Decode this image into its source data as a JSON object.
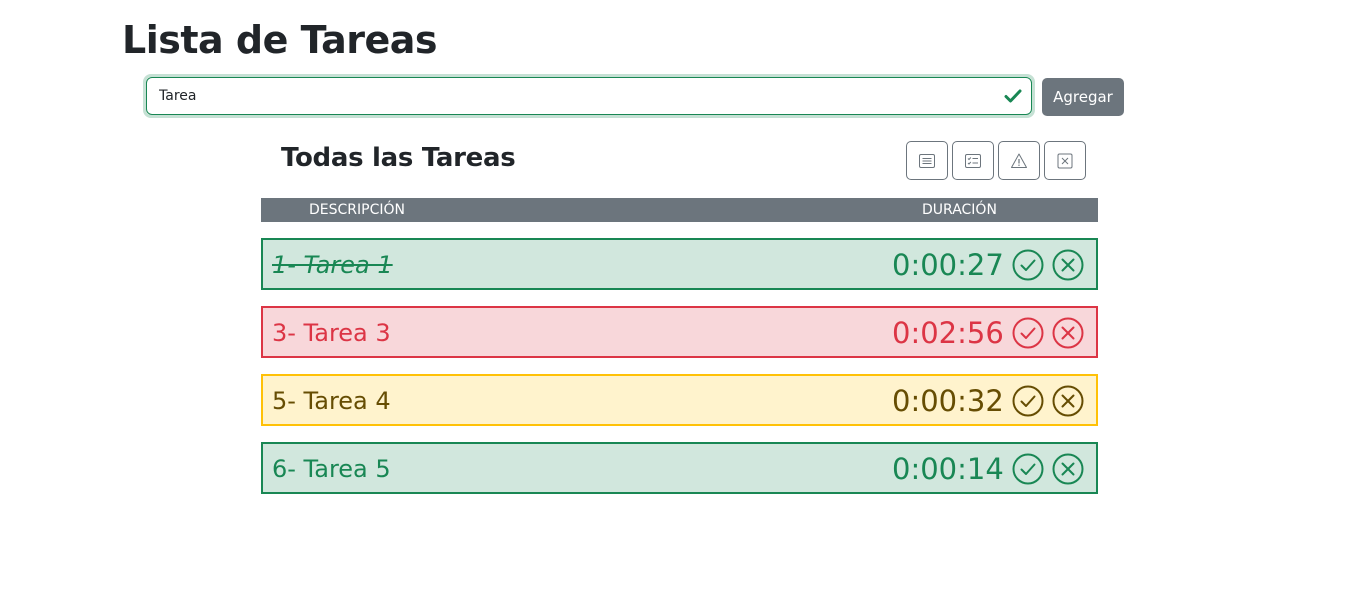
{
  "title": "Lista de Tareas",
  "form": {
    "input_value": "Tarea",
    "add_label": "Agregar"
  },
  "section_title": "Todas las Tareas",
  "filters": [
    {
      "icon": "list-icon"
    },
    {
      "icon": "checklist-icon"
    },
    {
      "icon": "warning-icon"
    },
    {
      "icon": "x-square-icon"
    }
  ],
  "table": {
    "headers": {
      "description": "DESCRIPCIÓN",
      "duration": "DURACIÓN"
    },
    "tasks": [
      {
        "label": "1- Tarea 1",
        "time": "0:00:27",
        "status": "success",
        "done": true
      },
      {
        "label": "3- Tarea 3",
        "time": "0:02:56",
        "status": "danger",
        "done": false
      },
      {
        "label": "5- Tarea 4",
        "time": "0:00:32",
        "status": "warning",
        "done": false
      },
      {
        "label": "6- Tarea 5",
        "time": "0:00:14",
        "status": "success",
        "done": false
      }
    ]
  },
  "colors": {
    "success": "#198754",
    "danger": "#dc3545",
    "warning_border": "#ffc107",
    "warning_text": "#664d03",
    "secondary": "#6c757d"
  }
}
